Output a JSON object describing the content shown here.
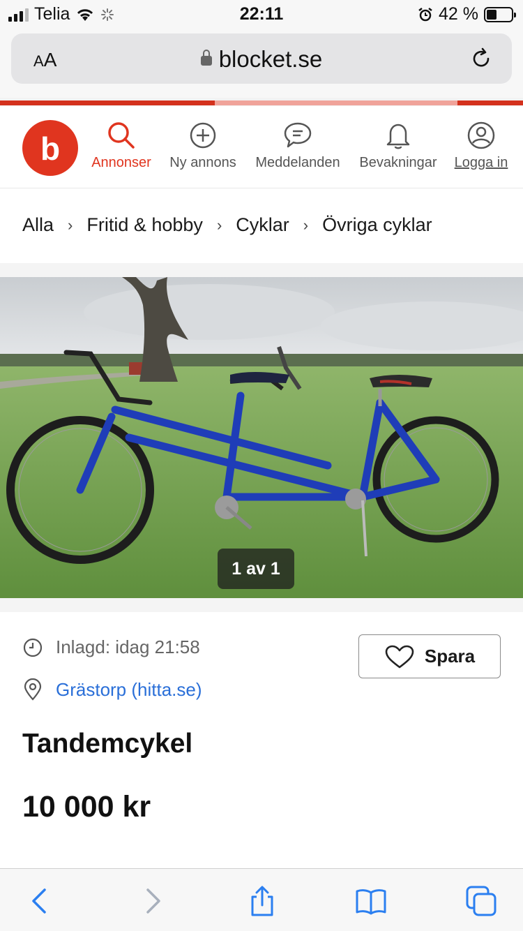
{
  "status_bar": {
    "carrier": "Telia",
    "time": "22:11",
    "battery_percent": "42 %",
    "battery_level": 0.42
  },
  "browser": {
    "text_size_label_small": "A",
    "text_size_label_large": "A",
    "url": "blocket.se"
  },
  "colors": {
    "brand_red": "#e0351f",
    "link_blue": "#2a6fd8"
  },
  "nav": {
    "logo_letter": "b",
    "items": [
      {
        "label": "Annonser",
        "icon": "search-icon",
        "active": true
      },
      {
        "label": "Ny annons",
        "icon": "plus-circle-icon"
      },
      {
        "label": "Meddelanden",
        "icon": "message-icon"
      },
      {
        "label": "Bevakningar",
        "icon": "bell-icon"
      },
      {
        "label": "Logga in",
        "icon": "user-icon"
      }
    ]
  },
  "breadcrumb": [
    "Alla",
    "Fritid & hobby",
    "Cyklar",
    "Övriga cyklar"
  ],
  "gallery": {
    "counter": "1 av 1"
  },
  "listing": {
    "posted": "Inlagd: idag 21:58",
    "location": "Grästorp (hitta.se)",
    "save_label": "Spara",
    "title": "Tandemcykel",
    "price": "10 000 kr"
  }
}
